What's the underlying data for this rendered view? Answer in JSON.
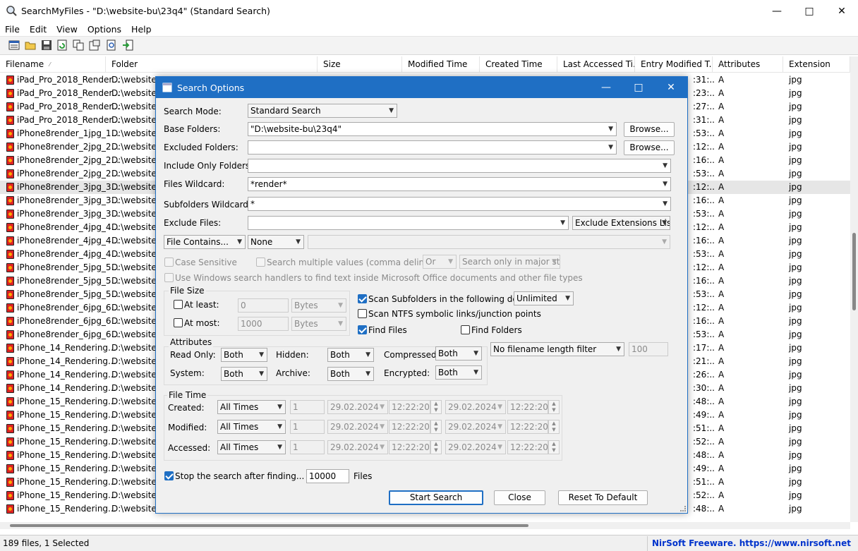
{
  "window": {
    "title": "SearchMyFiles -  \"D:\\website-bu\\23q4\"  (Standard Search)"
  },
  "menu": [
    "File",
    "Edit",
    "View",
    "Options",
    "Help"
  ],
  "columns": [
    "Filename",
    "Folder",
    "Size",
    "Modified Time",
    "Created Time",
    "Last Accessed Ti...",
    "Entry Modified T...",
    "Attributes",
    "Extension"
  ],
  "rows": [
    {
      "fn": "iPad_Pro_2018_Render...",
      "fo": "D:\\website-",
      "tm": ":31:..",
      "at": "A",
      "ex": "jpg"
    },
    {
      "fn": "iPad_Pro_2018_Render...",
      "fo": "D:\\website-",
      "tm": ":23:..",
      "at": "A",
      "ex": "jpg"
    },
    {
      "fn": "iPad_Pro_2018_Render...",
      "fo": "D:\\website-",
      "tm": ":27:..",
      "at": "A",
      "ex": "jpg"
    },
    {
      "fn": "iPad_Pro_2018_Render...",
      "fo": "D:\\website-",
      "tm": ":31:..",
      "at": "A",
      "ex": "jpg"
    },
    {
      "fn": "iPhone8render_1jpg_1...",
      "fo": "D:\\website-",
      "tm": ":53:..",
      "at": "A",
      "ex": "jpg"
    },
    {
      "fn": "iPhone8render_2jpg_2...",
      "fo": "D:\\website-",
      "tm": ":12:..",
      "at": "A",
      "ex": "jpg"
    },
    {
      "fn": "iPhone8render_2jpg_2...",
      "fo": "D:\\website-",
      "tm": ":16:..",
      "at": "A",
      "ex": "jpg"
    },
    {
      "fn": "iPhone8render_2jpg_2...",
      "fo": "D:\\website-",
      "tm": ":53:..",
      "at": "A",
      "ex": "jpg"
    },
    {
      "fn": "iPhone8render_3jpg_3...",
      "fo": "D:\\website-",
      "tm": ":12:..",
      "at": "A",
      "ex": "jpg"
    },
    {
      "fn": "iPhone8render_3jpg_3...",
      "fo": "D:\\website-",
      "tm": ":16:..",
      "at": "A",
      "ex": "jpg"
    },
    {
      "fn": "iPhone8render_3jpg_3...",
      "fo": "D:\\website-",
      "tm": ":53:..",
      "at": "A",
      "ex": "jpg"
    },
    {
      "fn": "iPhone8render_4jpg_4...",
      "fo": "D:\\website-",
      "tm": ":12:..",
      "at": "A",
      "ex": "jpg"
    },
    {
      "fn": "iPhone8render_4jpg_4...",
      "fo": "D:\\website-",
      "tm": ":16:..",
      "at": "A",
      "ex": "jpg"
    },
    {
      "fn": "iPhone8render_4jpg_4...",
      "fo": "D:\\website-",
      "tm": ":53:..",
      "at": "A",
      "ex": "jpg"
    },
    {
      "fn": "iPhone8render_5jpg_5...",
      "fo": "D:\\website-",
      "tm": ":12:..",
      "at": "A",
      "ex": "jpg"
    },
    {
      "fn": "iPhone8render_5jpg_5...",
      "fo": "D:\\website-",
      "tm": ":16:..",
      "at": "A",
      "ex": "jpg"
    },
    {
      "fn": "iPhone8render_5jpg_5...",
      "fo": "D:\\website-",
      "tm": ":53:..",
      "at": "A",
      "ex": "jpg"
    },
    {
      "fn": "iPhone8render_6jpg_6...",
      "fo": "D:\\website-",
      "tm": ":12:..",
      "at": "A",
      "ex": "jpg"
    },
    {
      "fn": "iPhone8render_6jpg_6...",
      "fo": "D:\\website-",
      "tm": ":16:..",
      "at": "A",
      "ex": "jpg"
    },
    {
      "fn": "iPhone8render_6jpg_6...",
      "fo": "D:\\website-",
      "tm": ":53:..",
      "at": "A",
      "ex": "jpg"
    },
    {
      "fn": "iPhone_14_Rendering...",
      "fo": "D:\\website-",
      "tm": ":17:..",
      "at": "A",
      "ex": "jpg"
    },
    {
      "fn": "iPhone_14_Rendering...",
      "fo": "D:\\website-",
      "tm": ":21:..",
      "at": "A",
      "ex": "jpg"
    },
    {
      "fn": "iPhone_14_Rendering...",
      "fo": "D:\\website-",
      "tm": ":26:..",
      "at": "A",
      "ex": "jpg"
    },
    {
      "fn": "iPhone_14_Rendering...",
      "fo": "D:\\website-",
      "tm": ":30:..",
      "at": "A",
      "ex": "jpg"
    },
    {
      "fn": "iPhone_15_Rendering...",
      "fo": "D:\\website-",
      "tm": ":48:..",
      "at": "A",
      "ex": "jpg"
    },
    {
      "fn": "iPhone_15_Rendering...",
      "fo": "D:\\website-",
      "tm": ":49:..",
      "at": "A",
      "ex": "jpg"
    },
    {
      "fn": "iPhone_15_Rendering...",
      "fo": "D:\\website-",
      "tm": ":51:..",
      "at": "A",
      "ex": "jpg"
    },
    {
      "fn": "iPhone_15_Rendering...",
      "fo": "D:\\website-",
      "tm": ":52:..",
      "at": "A",
      "ex": "jpg"
    },
    {
      "fn": "iPhone_15_Rendering...",
      "fo": "D:\\website-",
      "tm": ":48:..",
      "at": "A",
      "ex": "jpg"
    },
    {
      "fn": "iPhone_15_Rendering...",
      "fo": "D:\\website-",
      "tm": ":49:..",
      "at": "A",
      "ex": "jpg"
    },
    {
      "fn": "iPhone_15_Rendering...",
      "fo": "D:\\website-",
      "tm": ":51:..",
      "at": "A",
      "ex": "jpg"
    },
    {
      "fn": "iPhone_15_Rendering...",
      "fo": "D:\\website-",
      "tm": ":52:..",
      "at": "A",
      "ex": "jpg"
    },
    {
      "fn": "iPhone_15_Rendering...",
      "fo": "D:\\website-",
      "tm": ":48:..",
      "at": "A",
      "ex": "jpg"
    }
  ],
  "status": {
    "left": "189 files, 1 Selected",
    "right": "NirSoft Freeware. https://www.nirsoft.net"
  },
  "dialog": {
    "title": "Search Options",
    "search_mode_label": "Search Mode:",
    "search_mode": "Standard Search",
    "base_folders_label": "Base Folders:",
    "base_folders": "\"D:\\website-bu\\23q4\"",
    "browse": "Browse...",
    "excluded_folders_label": "Excluded Folders:",
    "include_only_label": "Include Only Folders:",
    "files_wildcard_label": "Files Wildcard:",
    "files_wildcard": "*render*",
    "subfolders_wildcard_label": "Subfolders Wildcard:",
    "subfolders_wildcard": "*",
    "exclude_files_label": "Exclude Files:",
    "exclude_ext": "Exclude Extensions List",
    "file_contains": "File Contains...",
    "none": "None",
    "case_sensitive": "Case Sensitive",
    "search_multiple": "Search multiple values (comma delimited)",
    "or": "Or",
    "major_streams": "Search only in major stre",
    "use_windows": "Use Windows search handlers to find text inside Microsoft Office documents and other file types",
    "file_size": "File Size",
    "at_least": "At least:",
    "at_most": "At most:",
    "at_least_val": "0",
    "at_most_val": "1000",
    "bytes": "Bytes",
    "scan_subfolders": "Scan Subfolders in the following depth:",
    "depth": "Unlimited",
    "scan_ntfs": "Scan NTFS symbolic links/junction points",
    "find_files": "Find Files",
    "find_folders": "Find Folders",
    "attributes": "Attributes",
    "read_only": "Read Only:",
    "hidden": "Hidden:",
    "compressed": "Compressed:",
    "system": "System:",
    "archive": "Archive:",
    "encrypted": "Encrypted:",
    "both": "Both",
    "filename_length": "No filename length filter",
    "filename_length_val": "100",
    "file_time": "File Time",
    "created": "Created:",
    "modified": "Modified:",
    "accessed": "Accessed:",
    "all_times": "All Times",
    "one": "1",
    "date": "29.02.2024",
    "time": "12:22:20",
    "stop_after": "Stop the search after finding...",
    "stop_val": "10000",
    "files": "Files",
    "start": "Start Search",
    "close": "Close",
    "reset": "Reset To Default"
  },
  "colors": {
    "accent": "#1f6fc4",
    "nirsoft": "#0033cc"
  }
}
